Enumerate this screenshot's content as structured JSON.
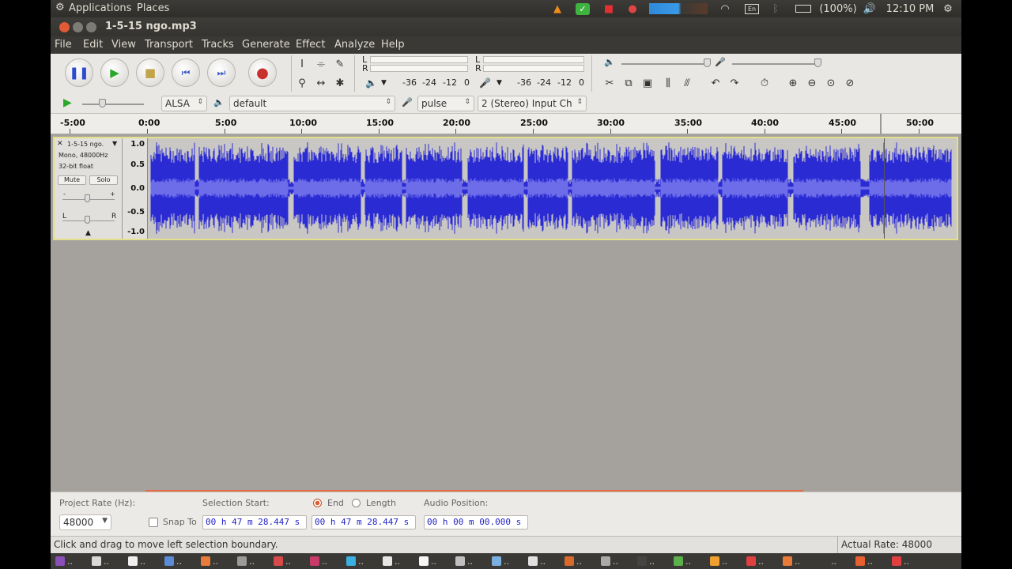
{
  "colors": {
    "waveform": "#2b2bd4",
    "waveform_rms": "#6d6dea",
    "track_selected_border": "#e4e08a",
    "record": "#c8302c",
    "play": "#2aa82a",
    "panel_bg": "#2b2a27"
  },
  "top_panel": {
    "applications": "Applications",
    "places": "Places",
    "battery": "(100%)",
    "clock": "12:10 PM",
    "icons": [
      "vlc-icon",
      "checkmark-icon",
      "camera-icon",
      "bug-icon",
      "audio-meter-icon",
      "wifi-icon",
      "keyboard-icon",
      "bluetooth-icon",
      "battery-icon",
      "volume-icon",
      "gear-icon"
    ]
  },
  "window": {
    "title": "1-5-15 ngo.mp3"
  },
  "menu": [
    "File",
    "Edit",
    "View",
    "Transport",
    "Tracks",
    "Generate",
    "Effect",
    "Analyze",
    "Help"
  ],
  "meters": {
    "play_lr": [
      "L",
      "R"
    ],
    "record_lr": [
      "L",
      "R"
    ],
    "db_ticks": [
      "-36",
      "-24",
      "-12",
      "0"
    ]
  },
  "device": {
    "host": "ALSA",
    "playback": "default",
    "recording": "pulse",
    "channels": "2 (Stereo) Input Ch"
  },
  "ruler": {
    "labels": [
      "-5:00",
      "0:00",
      "5:00",
      "10:00",
      "15:00",
      "20:00",
      "25:00",
      "30:00",
      "35:00",
      "40:00",
      "45:00",
      "50:00"
    ]
  },
  "track": {
    "name": "1-5-15 ngo.",
    "rate_info": "Mono, 48000Hz",
    "format_info": "32-bit float",
    "mute": "Mute",
    "solo": "Solo",
    "gain_left": "-",
    "gain_right": "+",
    "pan_left": "L",
    "pan_right": "R",
    "scale": [
      "1.0",
      "0.5",
      "0.0",
      "-0.5",
      "-1.0"
    ]
  },
  "selection_bar": {
    "project_rate_label": "Project Rate (Hz):",
    "project_rate": "48000",
    "snap_to": "Snap To",
    "selection_start_label": "Selection Start:",
    "end_label": "End",
    "length_label": "Length",
    "audio_position_label": "Audio Position:",
    "selection_start": "00 h 47 m 28.447 s",
    "selection_end": "00 h 47 m 28.447 s",
    "audio_position": "00 h 00 m 00.000 s"
  },
  "status": {
    "message": "Click and drag to move left selection boundary.",
    "actual_rate": "Actual Rate: 48000"
  },
  "taskbar": {
    "items": [
      "..",
      "..",
      "..",
      "..",
      "..",
      "..",
      "..",
      "..",
      "..",
      "..",
      "..",
      "..",
      "..",
      "..",
      "..",
      "..",
      "..",
      "..",
      "..",
      "..",
      "..",
      "..",
      "..",
      ".."
    ]
  }
}
